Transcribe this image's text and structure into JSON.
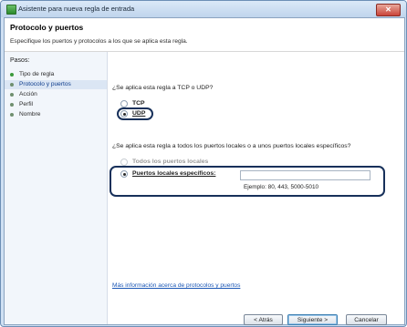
{
  "window": {
    "title": "Asistente para nueva regla de entrada",
    "close_glyph": "✕"
  },
  "header": {
    "title": "Protocolo y puertos",
    "description": "Especifique los puertos y protocolos a los que se aplica esta regla."
  },
  "sidebar": {
    "title": "Pasos:",
    "steps": [
      {
        "label": "Tipo de regla",
        "state": "done"
      },
      {
        "label": "Protocolo y puertos",
        "state": "active"
      },
      {
        "label": "Acción",
        "state": "pending"
      },
      {
        "label": "Perfil",
        "state": "pending"
      },
      {
        "label": "Nombre",
        "state": "pending"
      }
    ]
  },
  "protocol": {
    "question": "¿Se aplica esta regla a TCP o UDP?",
    "options": [
      {
        "label": "TCP",
        "selected": false
      },
      {
        "label": "UDP",
        "selected": true
      }
    ]
  },
  "ports": {
    "question": "¿Se aplica esta regla a todos los puertos locales o a unos puertos locales específicos?",
    "options": [
      {
        "label": "Todos los puertos locales",
        "selected": false
      },
      {
        "label": "Puertos locales específicos:",
        "selected": true
      }
    ],
    "input_value": "",
    "example": "Ejemplo: 80, 443, 5000-5010"
  },
  "link": "Más información acerca de protocolos y puertos",
  "buttons": {
    "back": "< Atrás",
    "next": "Siguiente >",
    "cancel": "Cancelar"
  },
  "colors": {
    "link": "#1a56b5",
    "highlight_border": "#17305a",
    "active_step": "#0d3c8c"
  }
}
